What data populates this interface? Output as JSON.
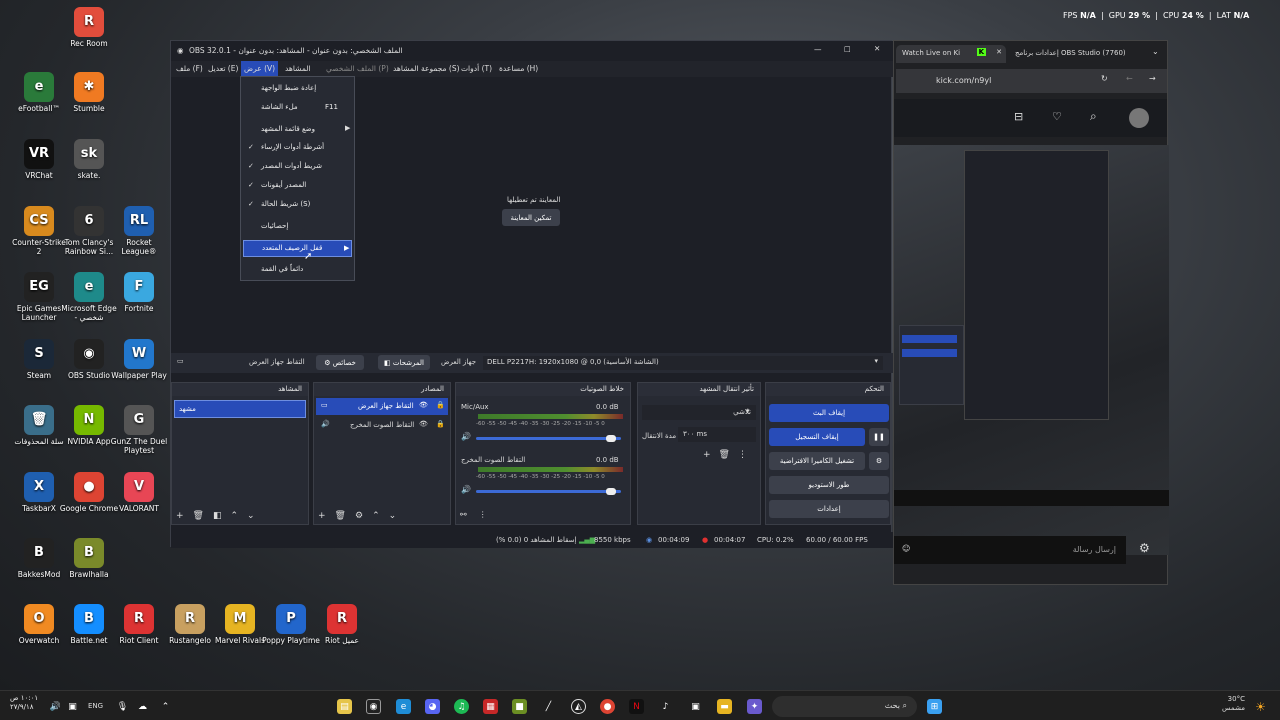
{
  "overlay": {
    "fps_label": "FPS",
    "fps_val": "N/A",
    "gpu_label": "GPU",
    "gpu_val": "29 %",
    "cpu_label": "CPU",
    "cpu_val": "24 %",
    "lat_label": "LAT",
    "lat_val": "N/A"
  },
  "desktop": [
    {
      "label": "Rec Room",
      "color": "#e24d3c",
      "glyph": "R"
    },
    {
      "label": "eFootball™",
      "color": "#2a7a3a",
      "glyph": "e"
    },
    {
      "label": "Stumble",
      "color": "#f07a22",
      "glyph": "✱"
    },
    {
      "label": "VRChat",
      "color": "#111",
      "glyph": "VR"
    },
    {
      "label": "skate.",
      "color": "#555",
      "glyph": "sk"
    },
    {
      "label": "Counter-Strike 2",
      "color": "#d88a1e",
      "glyph": "CS"
    },
    {
      "label": "Tom Clancy's Rainbow Si...",
      "color": "#333",
      "glyph": "6"
    },
    {
      "label": "Rocket League®",
      "color": "#1f5fb0",
      "glyph": "RL"
    },
    {
      "label": "Epic Games Launcher",
      "color": "#222",
      "glyph": "EG"
    },
    {
      "label": "Microsoft Edge - شخصي",
      "color": "#1e8a8a",
      "glyph": "e"
    },
    {
      "label": "Fortnite",
      "color": "#3aa8e0",
      "glyph": "F"
    },
    {
      "label": "Steam",
      "color": "#1b2838",
      "glyph": "S"
    },
    {
      "label": "OBS Studio",
      "color": "#222",
      "glyph": "◉"
    },
    {
      "label": "Wallpaper Play",
      "color": "#2277cc",
      "glyph": "W"
    },
    {
      "label": "سلة المحذوفات",
      "color": "#3a6e8a",
      "glyph": "🗑"
    },
    {
      "label": "NVIDIA App",
      "color": "#76b900",
      "glyph": "N"
    },
    {
      "label": "GunZ The Duel Playtest",
      "color": "#555",
      "glyph": "G"
    },
    {
      "label": "TaskbarX",
      "color": "#1f5fb0",
      "glyph": "X"
    },
    {
      "label": "Google Chrome",
      "color": "#dd4433",
      "glyph": "●"
    },
    {
      "label": "VALORANT",
      "color": "#e84655",
      "glyph": "V"
    },
    {
      "label": "BakkesMod",
      "color": "#222",
      "glyph": "B"
    },
    {
      "label": "Brawlhalla",
      "color": "#7a8a2a",
      "glyph": "B"
    },
    {
      "label": "Overwatch",
      "color": "#f08a22",
      "glyph": "O"
    },
    {
      "label": "Battle.net",
      "color": "#148eff",
      "glyph": "B"
    },
    {
      "label": "Riot Client",
      "color": "#d33",
      "glyph": "R"
    },
    {
      "label": "Rustangelo",
      "color": "#c8a060",
      "glyph": "R"
    },
    {
      "label": "Marvel Rivals",
      "color": "#e6b422",
      "glyph": "M"
    },
    {
      "label": "Poppy Playtime",
      "color": "#2266cc",
      "glyph": "P"
    },
    {
      "label": "Riot عميل",
      "color": "#d33",
      "glyph": "R"
    }
  ],
  "browser": {
    "tab1": "Watch Live on Ki",
    "tab2": "إعدادات برنامج OBS Studio (7760)",
    "url": "kick.com/n9yl",
    "chat_placeholder": "إرسال رسالة"
  },
  "obs": {
    "title": "OBS 32.0.1 - الملف الشخصي: بدون عنوان - المشاهد: بدون عنوان",
    "menu": [
      "ملف (F)",
      "تعديل (E)",
      "عرض (V)",
      "المشاهد",
      "الملف الشخصي (P)",
      "مجموعة المشاهد (S)",
      "أدوات (T)",
      "مساعدة (H)"
    ],
    "view_menu": [
      "إعادة ضبط الواجهة",
      "ملء الشاشة",
      "F11",
      "وضع قائمة المشهد",
      "أشرطة أدوات الإرساء",
      "شريط أدوات المصدر",
      "المصدر أيقونات",
      "شريط الحالة (S)",
      "إحصائيات",
      "قفل الرصيف المتعدد",
      "دائماً في القمة"
    ],
    "preview_msg": "المعاينة تم تعطيلها",
    "preview_btn": "تمكين المعاينة",
    "source_bar": {
      "label": "التقاط جهاز العرض",
      "props": "خصائص",
      "filters": "المرشحات",
      "device_label": "جهاز العرض",
      "device": "DELL P2217H: 1920x1080 @ 0,0 (الشاشة الأساسية)"
    },
    "scenes": {
      "title": "المشاهد",
      "item": "مشهد"
    },
    "sources": {
      "title": "المصادر",
      "items": [
        "التقاط جهاز العرض",
        "التقاط الصوت المخرج"
      ]
    },
    "mixer": {
      "title": "خلاط الصوتيات",
      "ch1": "Mic/Aux",
      "ch1_db": "0.0 dB",
      "ch2": "التقاط الصوت المخرج",
      "ch2_db": "0.0 dB",
      "ticks": "-60 -55 -50 -45 -40 -35 -30 -25 -20 -15 -10 -5 0"
    },
    "transitions": {
      "title": "تأثير انتقال المشهد",
      "type": "تلاشي",
      "dur_label": "مدة الانتقال",
      "dur": "٣٠٠ ms"
    },
    "controls": {
      "title": "التحكم",
      "stream": "إيقاف البث",
      "record": "إيقاف التسجيل",
      "vcam": "تشغيل الكاميرا الافتراضية",
      "studio": "طور الاستوديو",
      "settings": "إعدادات"
    },
    "status": {
      "dropped": "إسقاط المشاهد 0 (0.0 %)",
      "bitrate": "8550 kbps",
      "stream_time": "00:04:09",
      "rec_time": "00:04:07",
      "cpu": "CPU: 0.2%",
      "fps": "60.00 / 60.00 FPS"
    }
  },
  "taskbar": {
    "lang": "ENG",
    "time": "١٠:٠١ ص",
    "date": "٢٧/٩/١٨",
    "search": "بحث",
    "weather_temp": "30°C",
    "weather_desc": "مشمس"
  }
}
